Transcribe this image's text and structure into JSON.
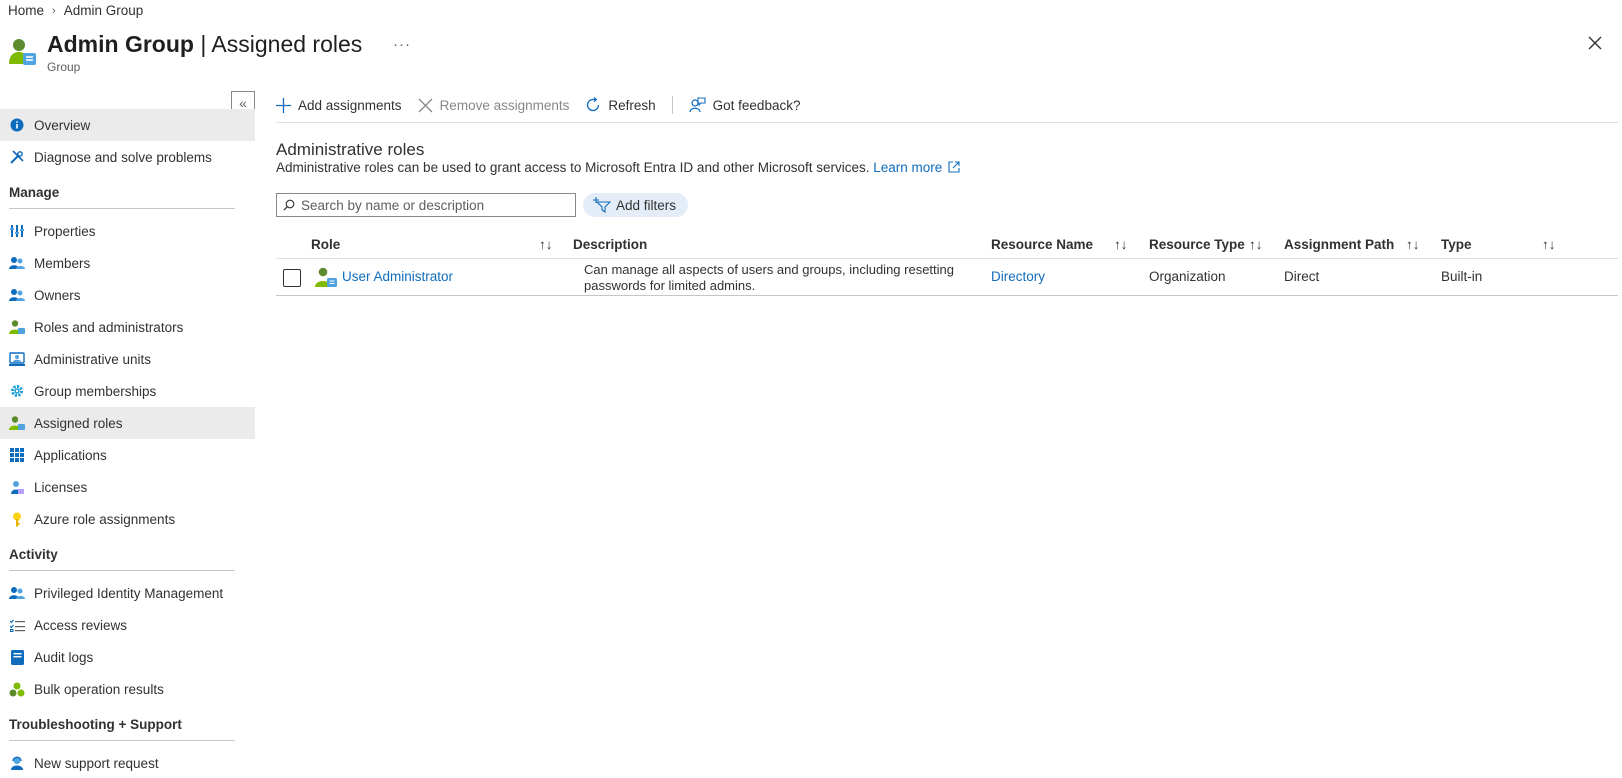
{
  "breadcrumb": {
    "home": "Home",
    "sep": "›",
    "current": "Admin Group"
  },
  "header": {
    "title_bold": "Admin Group",
    "title_rest": " | Assigned roles",
    "subtitle": "Group",
    "more": "···",
    "icon": "group-icon",
    "close_icon": "close-icon"
  },
  "collapse_label": "«",
  "sidebar": {
    "top_items": [
      {
        "label": "Overview",
        "icon": "info-icon",
        "active": true
      },
      {
        "label": "Diagnose and solve problems",
        "icon": "wrench-icon"
      }
    ],
    "sections": [
      {
        "title": "Manage",
        "items": [
          {
            "label": "Properties",
            "icon": "properties-icon"
          },
          {
            "label": "Members",
            "icon": "members-icon"
          },
          {
            "label": "Owners",
            "icon": "owners-icon"
          },
          {
            "label": "Roles and administrators",
            "icon": "roles-icon"
          },
          {
            "label": "Administrative units",
            "icon": "admin-units-icon"
          },
          {
            "label": "Group memberships",
            "icon": "gear-icon"
          },
          {
            "label": "Assigned roles",
            "icon": "roles-icon",
            "active": true
          },
          {
            "label": "Applications",
            "icon": "apps-grid-icon"
          },
          {
            "label": "Licenses",
            "icon": "license-icon"
          },
          {
            "label": "Azure role assignments",
            "icon": "key-icon"
          }
        ]
      },
      {
        "title": "Activity",
        "items": [
          {
            "label": "Privileged Identity Management",
            "icon": "members-icon"
          },
          {
            "label": "Access reviews",
            "icon": "checklist-icon"
          },
          {
            "label": "Audit logs",
            "icon": "log-icon"
          },
          {
            "label": "Bulk operation results",
            "icon": "bulk-icon"
          }
        ]
      },
      {
        "title": "Troubleshooting + Support",
        "items": [
          {
            "label": "New support request",
            "icon": "support-icon"
          }
        ]
      }
    ]
  },
  "toolbar": {
    "add": "Add assignments",
    "remove": "Remove assignments",
    "refresh": "Refresh",
    "feedback": "Got feedback?"
  },
  "content": {
    "title": "Administrative roles",
    "description": "Administrative roles can be used to grant access to Microsoft Entra ID and other Microsoft services.",
    "learn_more": "Learn more",
    "search_placeholder": "Search by name or description",
    "add_filters": "Add filters"
  },
  "table": {
    "columns": {
      "role": "Role",
      "description": "Description",
      "resource_name": "Resource Name",
      "resource_type": "Resource Type",
      "assignment_path": "Assignment Path",
      "type": "Type"
    },
    "sort_glyph": "↑↓",
    "rows": [
      {
        "role": "User Administrator",
        "description": "Can manage all aspects of users and groups, including resetting passwords for limited admins.",
        "resource_name": "Directory",
        "resource_type": "Organization",
        "assignment_path": "Direct",
        "type": "Built-in"
      }
    ]
  },
  "colors": {
    "accent": "#0f6cbd",
    "active_bg": "#ebebeb",
    "pill_bg": "#e3ecf7"
  }
}
